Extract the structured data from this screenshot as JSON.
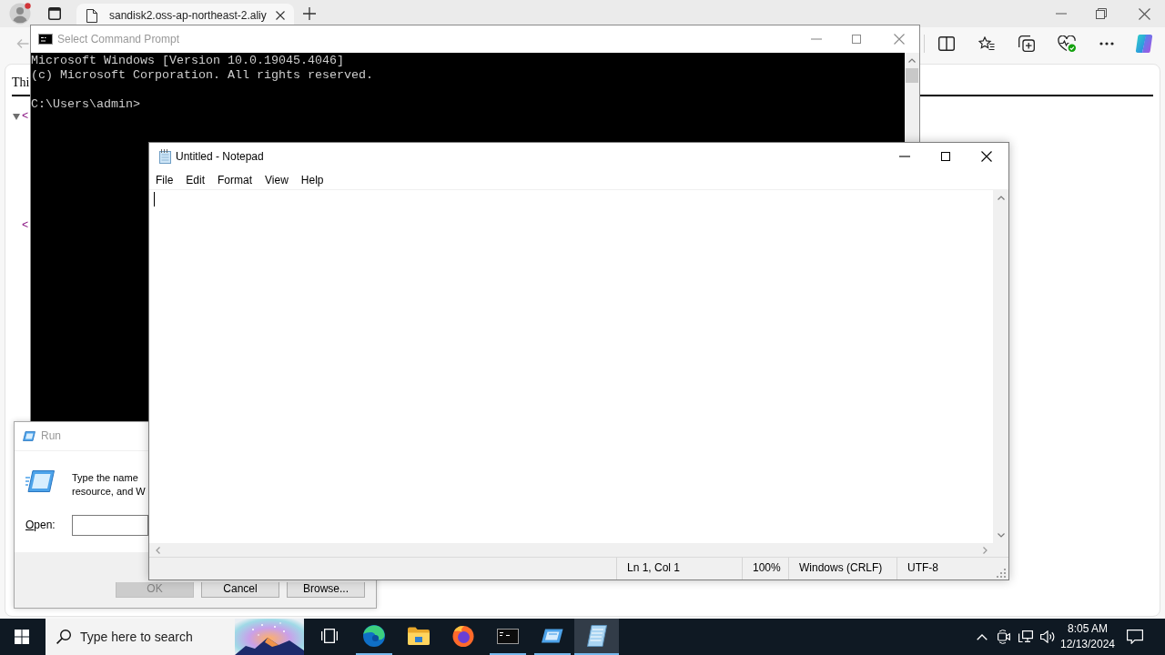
{
  "browser": {
    "tabs": [
      {
        "title": "sandisk2.oss-ap-northeast-2.aliy",
        "selected": true
      }
    ],
    "page": {
      "heading": "Thi",
      "tree": [
        {
          "kind": "element",
          "expanded": true,
          "text": "<"
        },
        {
          "kind": "closing",
          "text": "<"
        }
      ]
    }
  },
  "cmd_window": {
    "title": "Select Command Prompt",
    "active": false,
    "output": [
      "Microsoft Windows [Version 10.0.19045.4046]",
      "(c) Microsoft Corporation. All rights reserved."
    ],
    "prompt": "C:\\Users\\admin>"
  },
  "run_dialog": {
    "title": "Run",
    "active": false,
    "description": [
      "Type the name",
      "resource, and W"
    ],
    "open_label": "Open:",
    "buttons": [
      {
        "label": "OK",
        "disabled": true
      },
      {
        "label": "Cancel",
        "disabled": false
      },
      {
        "label": "Browse...",
        "disabled": false
      }
    ]
  },
  "notepad": {
    "title": "Untitled - Notepad",
    "active": true,
    "menu": [
      "File",
      "Edit",
      "Format",
      "View",
      "Help"
    ],
    "status_bar": [
      "Ln 1, Col 1",
      "100%",
      "Windows (CRLF)",
      "UTF-8"
    ]
  },
  "taskbar": {
    "search": {
      "placeholder": "Type here to search"
    },
    "apps": [
      {
        "kind": "task-view",
        "running": false,
        "selected": false
      },
      {
        "kind": "edge",
        "running": true,
        "selected": false
      },
      {
        "kind": "explorer",
        "running": false,
        "selected": false
      },
      {
        "kind": "firefox",
        "running": false,
        "selected": false
      },
      {
        "kind": "terminal",
        "running": true,
        "selected": false
      },
      {
        "kind": "run",
        "running": true,
        "selected": false
      },
      {
        "kind": "notepad",
        "running": true,
        "selected": true
      }
    ],
    "clock": {
      "time": "8:05 AM",
      "date": "12/13/2024"
    }
  }
}
